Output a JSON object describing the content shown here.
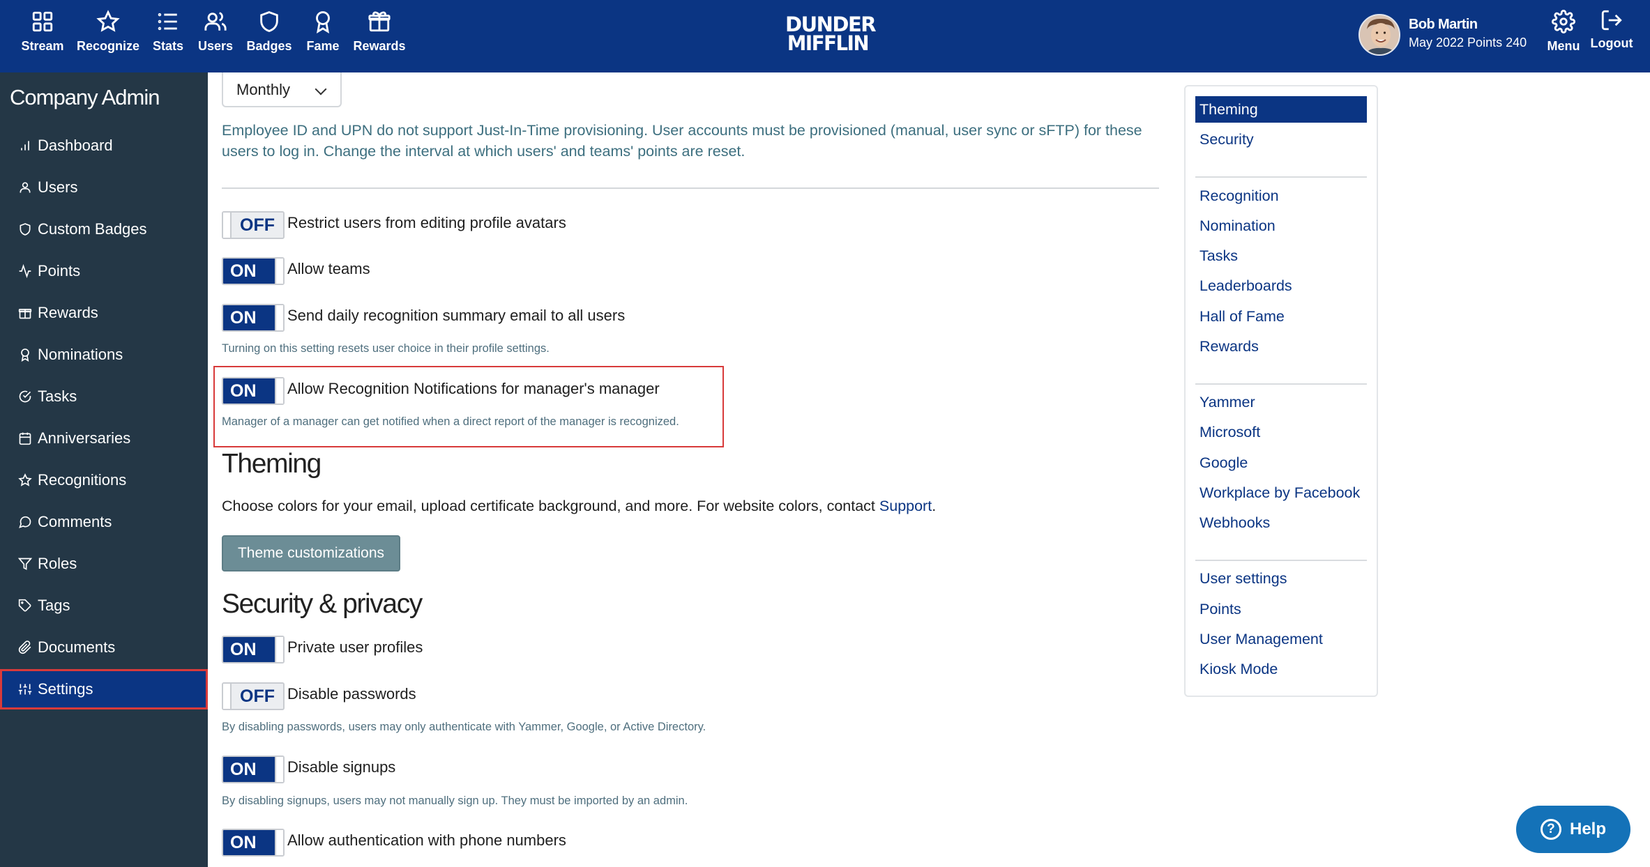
{
  "topnav": {
    "items": [
      {
        "label": "Stream",
        "icon": "grid-icon"
      },
      {
        "label": "Recognize",
        "icon": "star-icon"
      },
      {
        "label": "Stats",
        "icon": "list-icon"
      },
      {
        "label": "Users",
        "icon": "users-icon"
      },
      {
        "label": "Badges",
        "icon": "shield-icon"
      },
      {
        "label": "Fame",
        "icon": "award-icon"
      },
      {
        "label": "Rewards",
        "icon": "gift-icon"
      }
    ],
    "logo_line1": "DUNDER",
    "logo_line2": "MIFFLIN",
    "user_name": "Bob Martin",
    "user_points": "May 2022 Points 240",
    "menu_label": "Menu",
    "logout_label": "Logout"
  },
  "sidebar": {
    "title": "Company Admin",
    "items": [
      {
        "label": "Dashboard",
        "icon": "bar-chart-icon"
      },
      {
        "label": "Users",
        "icon": "user-icon"
      },
      {
        "label": "Custom Badges",
        "icon": "shield-icon"
      },
      {
        "label": "Points",
        "icon": "activity-icon"
      },
      {
        "label": "Rewards",
        "icon": "gift-icon"
      },
      {
        "label": "Nominations",
        "icon": "award-icon"
      },
      {
        "label": "Tasks",
        "icon": "check-circle-icon"
      },
      {
        "label": "Anniversaries",
        "icon": "calendar-icon"
      },
      {
        "label": "Recognitions",
        "icon": "star-icon"
      },
      {
        "label": "Comments",
        "icon": "comment-icon"
      },
      {
        "label": "Roles",
        "icon": "filter-icon"
      },
      {
        "label": "Tags",
        "icon": "tag-icon"
      },
      {
        "label": "Documents",
        "icon": "paperclip-icon"
      },
      {
        "label": "Settings",
        "icon": "sliders-icon"
      }
    ],
    "active": "Settings"
  },
  "main": {
    "interval_select": "Monthly",
    "interval_help": "Employee ID and UPN do not support Just-In-Time provisioning. User accounts must be provisioned (manual, user sync or sFTP) for these users to log in. Change the interval at which users' and teams' points are reset.",
    "interval_help_line1": "Employee ID and UPN do not support Just-In-Time provisioning. User accounts must be provisioned (manual, user sync or sFTP) for these",
    "interval_help_line2": "users to log in. Change the interval at which users' and teams' points are reset.",
    "toggles": [
      {
        "state": "OFF",
        "label": "Restrict users from editing profile avatars"
      },
      {
        "state": "ON",
        "label": "Allow teams"
      },
      {
        "state": "ON",
        "label": "Send daily recognition summary email to all users",
        "help": "Turning on this setting resets user choice in their profile settings."
      },
      {
        "state": "ON",
        "label": "Allow Recognition Notifications for manager's manager",
        "help": "Manager of a manager can get notified when a direct report of the manager is recognized."
      }
    ],
    "theming": {
      "heading": "Theming",
      "description": "Choose colors for your email, upload certificate background, and more. For website colors, contact",
      "support_link": "Support",
      "button": "Theme customizations"
    },
    "security": {
      "heading": "Security & privacy",
      "toggles": [
        {
          "state": "ON",
          "label": "Private user profiles"
        },
        {
          "state": "OFF",
          "label": "Disable passwords",
          "help": "By disabling passwords, users may only authenticate with Yammer, Google, or Active Directory."
        },
        {
          "state": "ON",
          "label": "Disable signups",
          "help": "By disabling signups, users may not manually sign up. They must be imported by an admin."
        },
        {
          "state": "ON",
          "label": "Allow authentication with phone numbers"
        }
      ]
    }
  },
  "rightnav": {
    "group1": [
      "Theming",
      "Security"
    ],
    "group2": [
      "Recognition",
      "Nomination",
      "Tasks",
      "Leaderboards",
      "Hall of Fame",
      "Rewards"
    ],
    "group3": [
      "Yammer",
      "Microsoft",
      "Google",
      "Workplace by Facebook",
      "Webhooks"
    ],
    "group4": [
      "User settings",
      "Points",
      "User Management",
      "Kiosk Mode"
    ],
    "active": "Theming"
  },
  "help_button": "Help",
  "colors": {
    "brand": "#0b3583",
    "sidebar_bg": "#243746",
    "highlight": "#d83a3a",
    "help_button": "#1472b8",
    "teal_text": "#3d6f7f"
  }
}
